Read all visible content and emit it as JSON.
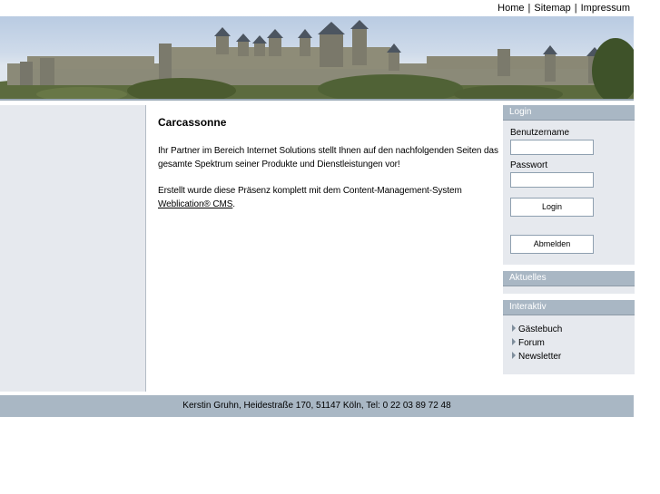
{
  "topnav": {
    "home": "Home",
    "sitemap": "Sitemap",
    "impressum": "Impressum",
    "separator": "|"
  },
  "main": {
    "title": "Carcassonne",
    "para1": "Ihr Partner im Bereich Internet Solutions stellt Ihnen auf den nachfolgenden Seiten das gesamte Spektrum seiner Produkte und Dienstleistungen vor!",
    "para2_prefix": "Erstellt wurde diese Präsenz komplett mit dem Content-Management-System ",
    "para2_link": "Weblication® CMS",
    "para2_suffix": "."
  },
  "login": {
    "header": "Login",
    "username_label": "Benutzername",
    "username_value": "",
    "password_label": "Passwort",
    "password_value": "",
    "login_button": "Login",
    "logout_button": "Abmelden"
  },
  "aktuelles": {
    "header": "Aktuelles"
  },
  "interaktiv": {
    "header": "Interaktiv",
    "items": [
      "Gästebuch",
      "Forum",
      "Newsletter"
    ]
  },
  "footer": {
    "text": "Kerstin Gruhn, Heidestraße 170, 51147 Köln, Tel: 0 22 03 89 72 48"
  },
  "colors": {
    "panel_bg": "#e6e9ee",
    "header_bg": "#a9b7c4",
    "footer_bg": "#a9b7c4"
  }
}
